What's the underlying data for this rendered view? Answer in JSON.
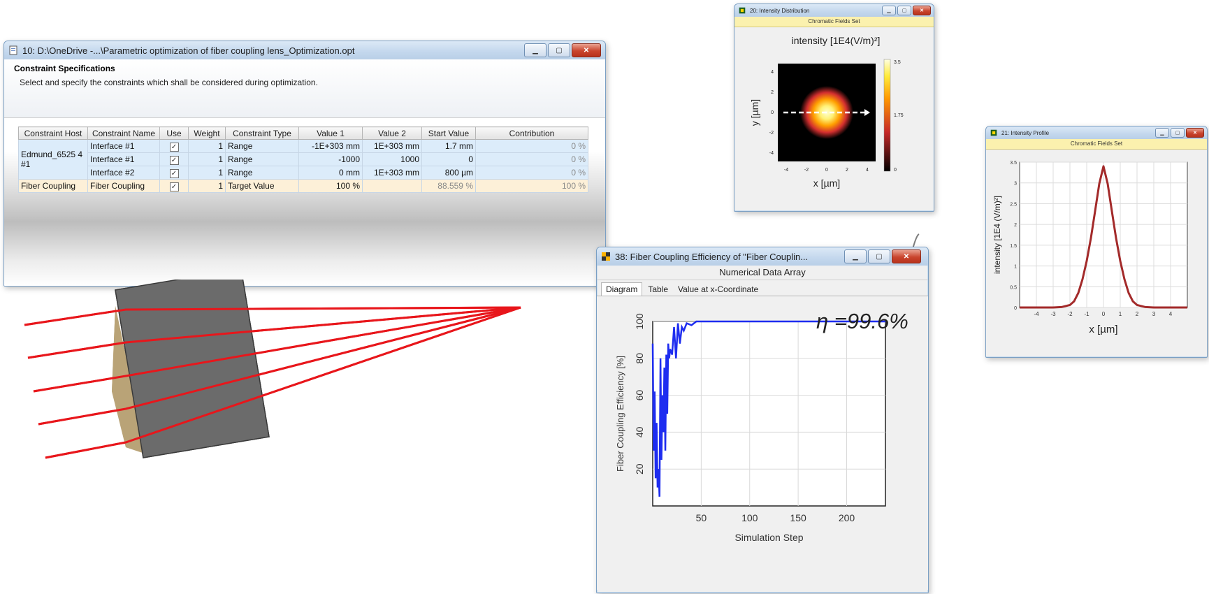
{
  "optimization_window": {
    "title": "10: D:\\OneDrive -...\\Parametric optimization of fiber coupling lens_Optimization.opt",
    "section_title": "Constraint Specifications",
    "section_desc": "Select and specify the constraints which shall be considered during optimization.",
    "columns": [
      "Constraint Host",
      "Constraint Name",
      "Use",
      "Weight",
      "Constraint Type",
      "Value 1",
      "Value 2",
      "Start Value",
      "Contribution"
    ],
    "host_1": "Edmund_6525 4 #1",
    "rows": [
      {
        "name": "Interface #1",
        "weight": "1",
        "type": "Range",
        "value1": "-1E+303 mm",
        "value2": "1E+303 mm",
        "start": "1.7 mm",
        "contribution": "0 %"
      },
      {
        "name": "Interface #1",
        "weight": "1",
        "type": "Range",
        "value1": "-1000",
        "value2": "1000",
        "start": "0",
        "contribution": "0 %"
      },
      {
        "name": "Interface #2",
        "weight": "1",
        "type": "Range",
        "value1": "0 mm",
        "value2": "1E+303 mm",
        "start": "800 µm",
        "contribution": "0 %"
      },
      {
        "host": "Fiber Coupling",
        "name": "Fiber Coupling",
        "weight": "1",
        "type": "Target Value",
        "value1": "100 %",
        "value2": "",
        "start": "88.559 %",
        "contribution": "100 %"
      }
    ]
  },
  "intensity_distribution_window": {
    "title": "20: Intensity Distribution",
    "subtitle": "Chromatic Fields Set",
    "plot_title": "intensity [1E4(V/m)²]",
    "xlabel": "x [µm]",
    "ylabel": "y [µm]",
    "x_ticks": [
      "-4",
      "-2",
      "0",
      "2",
      "4"
    ],
    "y_ticks": [
      "-4",
      "-2",
      "0",
      "2",
      "4"
    ],
    "colorbar_max": "3.5",
    "colorbar_mid": "1.75",
    "colorbar_min": "0"
  },
  "intensity_profile_window": {
    "title": "21: Intensity Profile",
    "subtitle": "Chromatic Fields Set",
    "ylabel": "intensity [1E4 (V/m)²]",
    "xlabel": "x [µm]"
  },
  "efficiency_window": {
    "title": "38: Fiber Coupling Efficiency of \"Fiber Couplin...",
    "subtitle": "Numerical Data Array",
    "tabs": [
      "Diagram",
      "Table",
      "Value at x-Coordinate"
    ],
    "annotation": "η =99.6%"
  },
  "colors": {
    "ray": "#e8161b",
    "efficiency_line": "#1e2df0",
    "profile_line": "#a32a2a",
    "row_blue": "#dcecfa",
    "row_orange": "#fdf0d8"
  },
  "chart_data": [
    {
      "type": "line",
      "title": "",
      "xlabel": "Simulation Step",
      "ylabel": "Fiber Coupling Efficiency [%]",
      "xlim": [
        0,
        240
      ],
      "ylim": [
        0,
        100
      ],
      "x_ticks": [
        50,
        100,
        150,
        200
      ],
      "y_ticks": [
        20,
        40,
        60,
        80,
        100
      ],
      "grid": true,
      "series": [
        {
          "x": [
            0,
            1,
            2,
            3,
            4,
            5,
            6,
            7,
            8,
            9,
            10,
            11,
            12,
            13,
            14,
            15,
            16,
            17,
            18,
            20,
            22,
            24,
            26,
            28,
            30,
            32,
            35,
            40,
            45,
            50,
            100,
            150,
            200,
            240
          ],
          "y": [
            88,
            30,
            62,
            15,
            45,
            10,
            20,
            5,
            80,
            25,
            60,
            40,
            75,
            30,
            82,
            50,
            88,
            80,
            85,
            82,
            97,
            80,
            99,
            88,
            97,
            95,
            99,
            98,
            100,
            100,
            100,
            100,
            100,
            100
          ]
        }
      ]
    },
    {
      "type": "line",
      "title": "",
      "xlabel": "x [µm]",
      "ylabel": "intensity [1E4 (V/m)²]",
      "xlim": [
        -5,
        5
      ],
      "ylim": [
        0,
        3.5
      ],
      "x_ticks": [
        -4,
        -3,
        -2,
        -1,
        0,
        1,
        2,
        3,
        4
      ],
      "y_ticks": [
        0,
        0.5,
        1,
        1.5,
        2,
        2.5,
        3,
        3.5
      ],
      "grid": true,
      "series": [
        {
          "x": [
            -5,
            -4,
            -3,
            -2.5,
            -2,
            -1.75,
            -1.5,
            -1.25,
            -1,
            -0.75,
            -0.5,
            -0.25,
            0,
            0.25,
            0.5,
            0.75,
            1,
            1.25,
            1.5,
            1.75,
            2,
            2.5,
            3,
            4,
            5
          ],
          "y": [
            0,
            0,
            0,
            0.01,
            0.06,
            0.15,
            0.35,
            0.68,
            1.12,
            1.67,
            2.32,
            2.98,
            3.4,
            2.98,
            2.32,
            1.67,
            1.12,
            0.68,
            0.35,
            0.15,
            0.06,
            0.01,
            0,
            0,
            0
          ]
        }
      ]
    }
  ]
}
